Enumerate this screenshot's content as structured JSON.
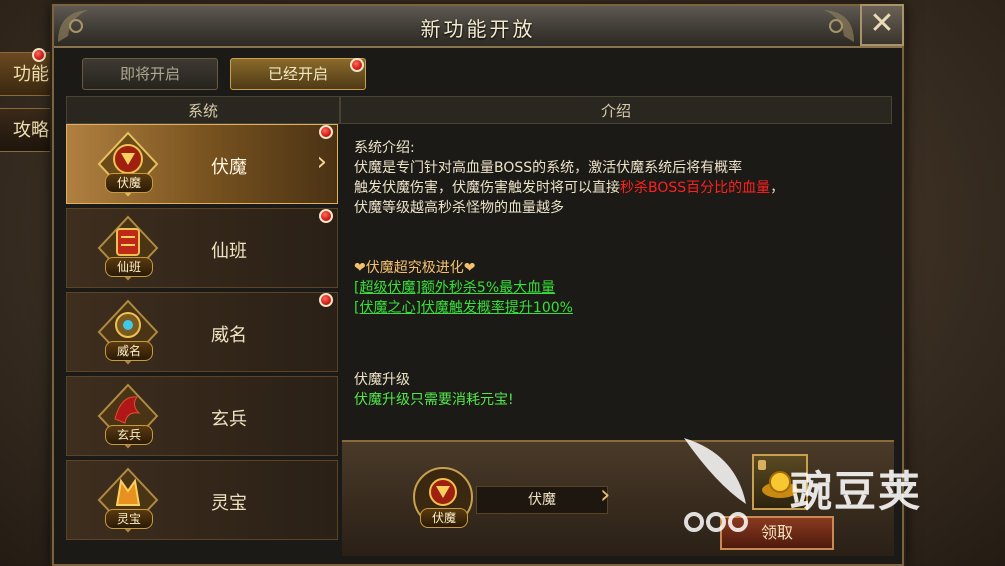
{
  "background_tabs": [
    {
      "label": "功能",
      "active": true,
      "badge": true
    },
    {
      "label": "攻略",
      "active": false,
      "badge": false
    }
  ],
  "window": {
    "title": "新功能开放",
    "close_symbol": "✕"
  },
  "tabs": [
    {
      "label": "即将开启",
      "active": false,
      "badge": false
    },
    {
      "label": "已经开启",
      "active": true,
      "badge": true
    }
  ],
  "columns": {
    "system": "系统",
    "intro": "介绍"
  },
  "systems": [
    {
      "name": "伏魔",
      "emblem_label": "伏魔",
      "selected": true,
      "badge": true,
      "icon": "demon-emblem-icon"
    },
    {
      "name": "仙班",
      "emblem_label": "仙班",
      "selected": false,
      "badge": true,
      "icon": "scroll-emblem-icon"
    },
    {
      "name": "威名",
      "emblem_label": "威名",
      "selected": false,
      "badge": true,
      "icon": "crown-emblem-icon"
    },
    {
      "name": "玄兵",
      "emblem_label": "玄兵",
      "selected": false,
      "badge": false,
      "icon": "dragon-emblem-icon"
    },
    {
      "name": "灵宝",
      "emblem_label": "灵宝",
      "selected": false,
      "badge": false,
      "icon": "treasure-emblem-icon"
    }
  ],
  "intro": {
    "heading": "系统介绍:",
    "line1": "伏魔是专门针对高血量BOSS的系统，激活伏魔系统后将有概率",
    "line2_a": "触发伏魔伤害，伏魔伤害触发时将可以直接",
    "line2_red": "秒杀BOSS百分比的血量",
    "line2_b": "，",
    "line3": "伏魔等级越高秒杀怪物的血量越多",
    "evolve_title": "伏魔超究极进化",
    "evolve_1": "[超级伏魔]额外秒杀5%最大血量",
    "evolve_2": "[伏魔之心]伏魔触发概率提升100%",
    "upgrade_title": "伏魔升级",
    "upgrade_text": "伏魔升级只需要消耗元宝!"
  },
  "bottom": {
    "emblem_label": "伏魔",
    "name": "伏魔",
    "reward_icon": "gold-ingot-icon",
    "claim_label": "领取"
  },
  "watermark": {
    "text": "豌豆荚"
  },
  "colors": {
    "red_text": "#ff2020",
    "green_text": "#36e03a",
    "accent_gold": "#c8a050"
  }
}
